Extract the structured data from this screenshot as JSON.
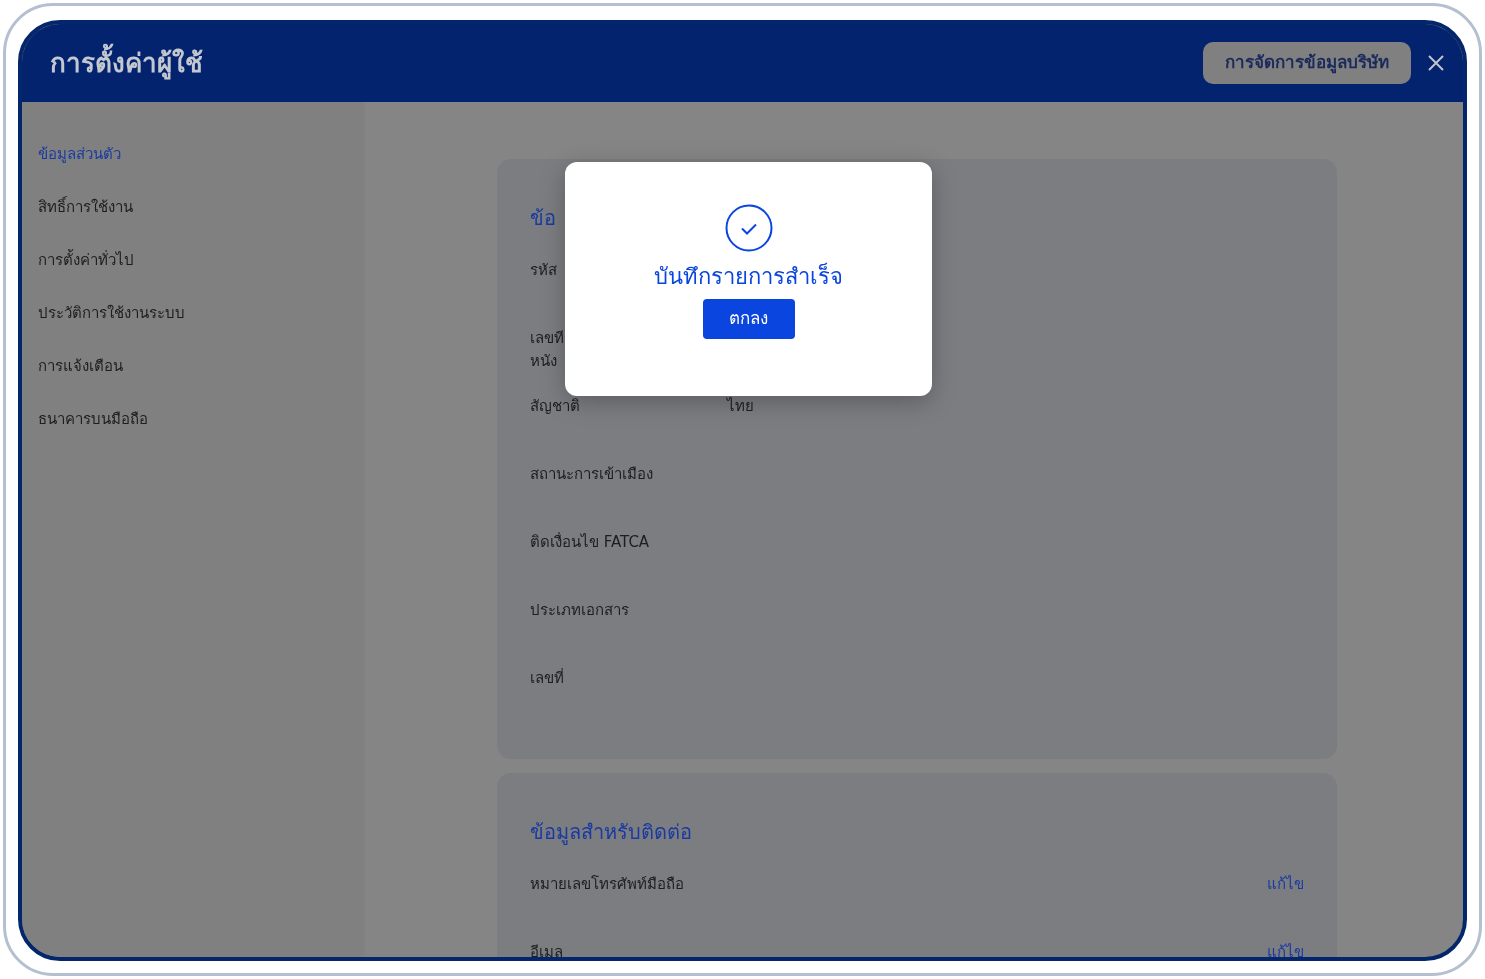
{
  "window": {
    "title": "การตั้งค่าผู้ใช้",
    "header_button": "การจัดการข้อมูลบริษัท"
  },
  "sidebar": {
    "items": [
      {
        "label": "ข้อมูลส่วนตัว",
        "selected": true
      },
      {
        "label": "สิทธิ์การใช้งาน",
        "selected": false
      },
      {
        "label": "การตั้งค่าทั่วไป",
        "selected": false
      },
      {
        "label": "ประวัติการใช้งานระบบ",
        "selected": false
      },
      {
        "label": "การแจ้งเตือน",
        "selected": false
      },
      {
        "label": "ธนาคารบนมือถือ",
        "selected": false
      }
    ]
  },
  "sections": [
    {
      "title": "ข้อ",
      "rows": [
        {
          "label": "รหัส"
        },
        {
          "label": "เลขที\nหนัง"
        },
        {
          "label": "สัญชาติ",
          "value": "ไทย"
        },
        {
          "label": "สถานะการเข้าเมือง"
        },
        {
          "label": "ติดเงื่อนไข FATCA"
        },
        {
          "label": "ประเภทเอกสาร"
        },
        {
          "label": "เลขที่"
        }
      ]
    },
    {
      "title": "ข้อมูลสำหรับติดต่อ",
      "rows": [
        {
          "label": "หมายเลขโทรศัพท์มือถือ",
          "action": "แก้ไข"
        },
        {
          "label": "อีเมล",
          "action": "แก้ไข"
        }
      ]
    }
  ],
  "modal": {
    "message": "บันทึกรายการสำเร็จ",
    "button": "ตกลง"
  }
}
